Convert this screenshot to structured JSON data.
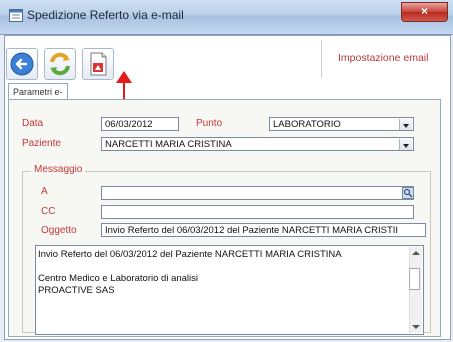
{
  "window": {
    "title": "Spedizione Referto via e-mail",
    "close_label": "×"
  },
  "toolbar": {
    "back_icon": "back-arrow-icon",
    "sync_icon": "refresh-icon",
    "pdf_icon": "pdf-document-icon",
    "impostazione_email": "Impostazione email"
  },
  "tabs": [
    {
      "label": "Parametri e-mail"
    }
  ],
  "form": {
    "data_label": "Data",
    "data_value": "06/03/2012",
    "punto_label": "Punto",
    "punto_value": "LABORATORIO",
    "paziente_label": "Paziente",
    "paziente_value": "NARCETTI MARIA CRISTINA"
  },
  "messaggio": {
    "legend": "Messaggio",
    "a_label": "A",
    "a_value": "",
    "cc_label": "CC",
    "cc_value": "",
    "oggetto_label": "Oggetto",
    "oggetto_value": "Invio Referto del 06/03/2012 del Paziente NARCETTI MARIA CRISTII",
    "body_line1": "Invio Referto del 06/03/2012 del Paziente NARCETTI MARIA CRISTINA",
    "body_line2": "",
    "body_line3": "Centro Medico e Laboratorio di analisi",
    "body_line4": "PROACTIVE SAS"
  },
  "colors": {
    "label_red": "#c4373b",
    "annotation": "#e21b1b",
    "link": "#b73a3a"
  }
}
